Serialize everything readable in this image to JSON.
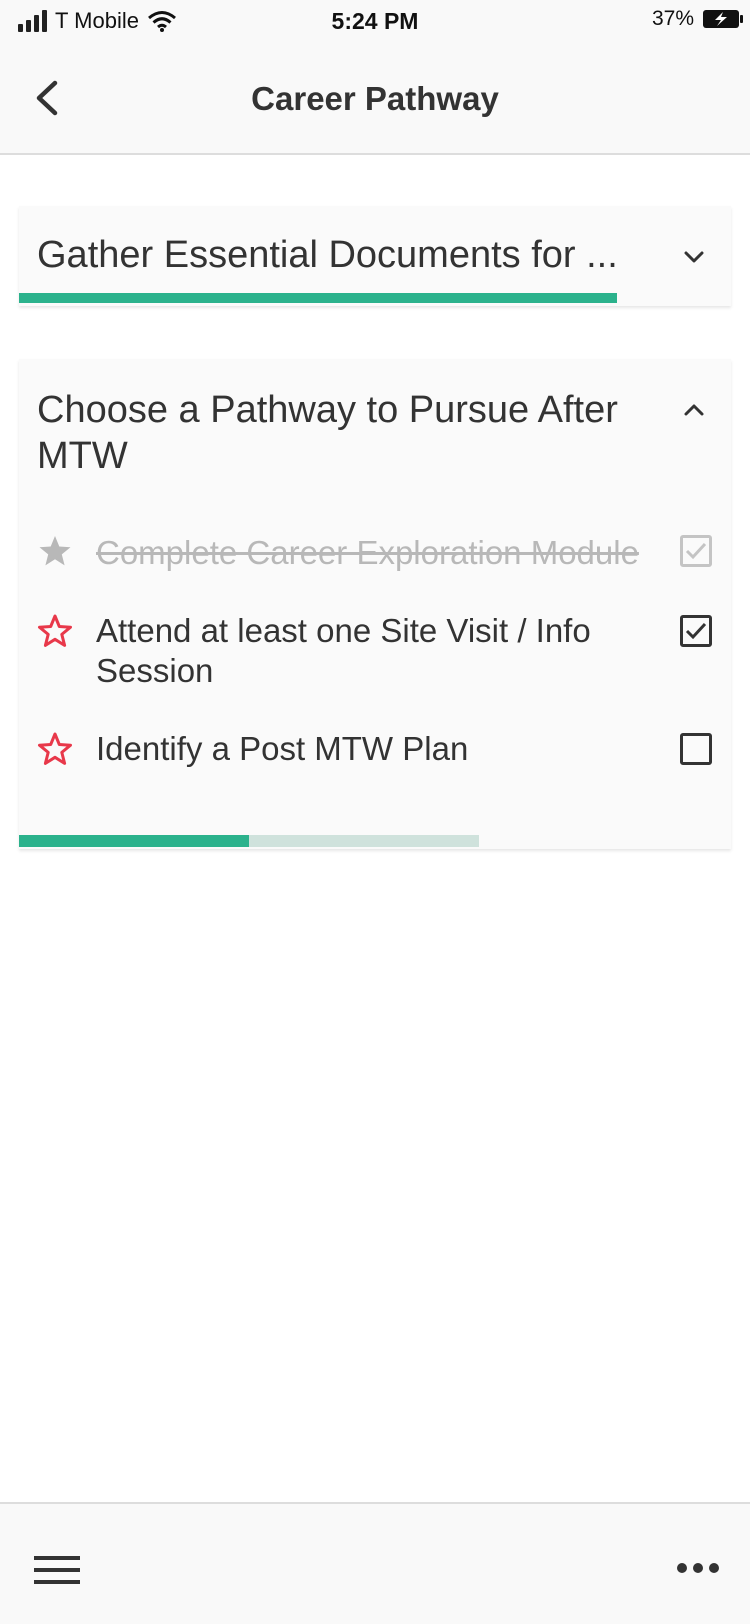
{
  "status_bar": {
    "carrier": "T Mobile",
    "time": "5:24 PM",
    "battery": "37%"
  },
  "nav": {
    "title": "Career Pathway",
    "back_icon": "chevron-left-icon"
  },
  "sections": [
    {
      "title": "Gather Essential Documents for ...",
      "expanded": false,
      "progress_fraction": 0.84
    },
    {
      "title": "Choose a Pathway to Pursue After MTW",
      "expanded": true,
      "progress_fraction": 0.5,
      "tasks": [
        {
          "label": "Complete Career Exploration Module",
          "completed": true,
          "checked": true
        },
        {
          "label": "Attend at least one Site Visit / Info Session",
          "completed": false,
          "checked": true
        },
        {
          "label": "Identify a Post MTW Plan",
          "completed": false,
          "checked": false
        }
      ]
    }
  ],
  "colors": {
    "accent": "#2bb28c",
    "track": "#cfe2dc",
    "star_active": "#e8384a",
    "star_done": "#b8b8b8"
  },
  "bottom_bar": {
    "menu_icon": "hamburger-menu-icon",
    "more_icon": "more-horizontal-icon"
  }
}
